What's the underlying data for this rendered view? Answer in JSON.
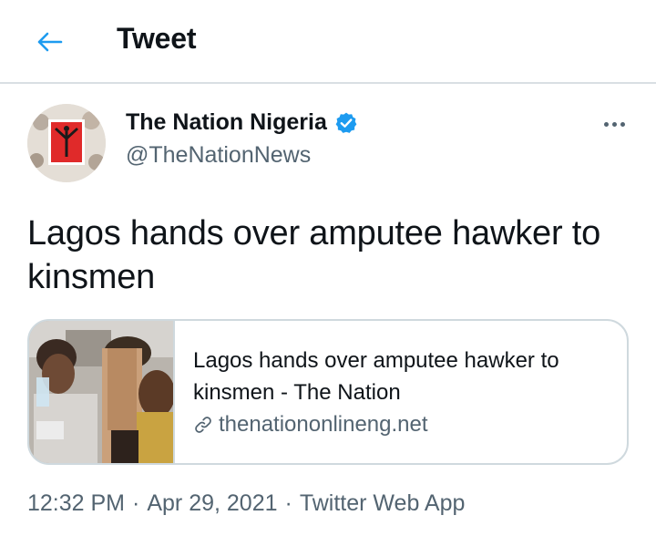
{
  "header": {
    "title": "Tweet",
    "back_icon": "arrow-left-icon",
    "accent_color": "#1d9bf0"
  },
  "author": {
    "name": "The Nation Nigeria",
    "handle": "@TheNationNews",
    "verified": true,
    "verified_color": "#1d9bf0"
  },
  "tweet": {
    "text": "Lagos hands over amputee hawker to kinsmen"
  },
  "card": {
    "title": "Lagos hands over amputee hawker to kinsmen - The Nation",
    "domain": "thenationonlineng.net",
    "link_icon": "link-icon"
  },
  "meta": {
    "time": "12:32 PM",
    "date": "Apr 29, 2021",
    "source": "Twitter Web App",
    "separator": "·"
  },
  "icons": {
    "more": "more-horizontal-icon"
  }
}
